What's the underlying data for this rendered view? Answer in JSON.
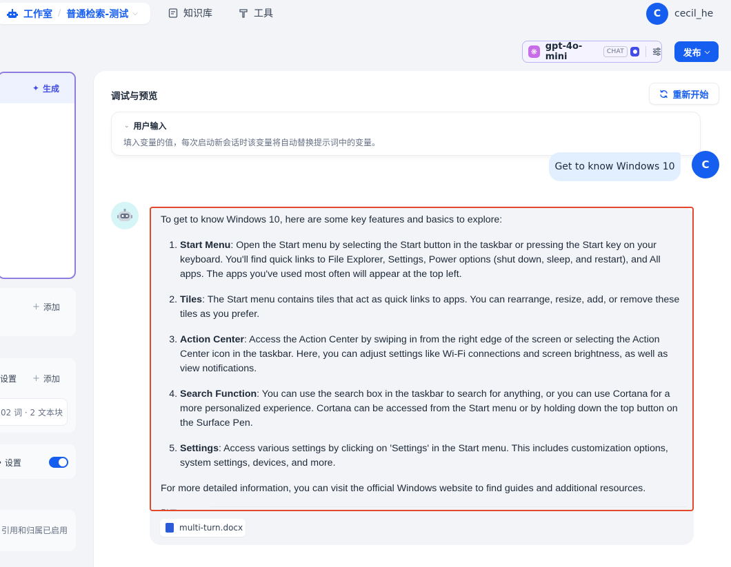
{
  "nav": {
    "studio": "工作室",
    "app_name": "普通检索-测试",
    "knowledge": "知识库",
    "tools": "工具",
    "user_initial": "C",
    "username": "cecil_he"
  },
  "left": {
    "generate": "生成",
    "add_1": "添加",
    "settings_1": "设置",
    "add_2": "添加",
    "doc_info": "02 词 · 2 文本块",
    "settings_2": "设置",
    "citation_status": "引用和归属已启用"
  },
  "toolbar": {
    "model": "gpt-4o-mini",
    "mode_badge": "CHAT",
    "publish": "发布"
  },
  "debug": {
    "title": "调试与预览",
    "restart": "重新开始",
    "user_input_title": "用户输入",
    "user_input_desc": "填入变量的值，每次启动新会话时该变量将自动替换提示词中的变量。"
  },
  "chat": {
    "user_message": "Get to know Windows 10",
    "user_initial": "C",
    "answer_intro": "To get to know Windows 10, here are some key features and basics to explore:",
    "items": [
      {
        "term": "Start Menu",
        "text": ": Open the Start menu by selecting the Start button in the taskbar or pressing the Start key on your keyboard. You'll find quick links to File Explorer, Settings, Power options (shut down, sleep, and restart), and All apps. The apps you've used most often will appear at the top left."
      },
      {
        "term": "Tiles",
        "text": ": The Start menu contains tiles that act as quick links to apps. You can rearrange, resize, add, or remove these tiles as you prefer."
      },
      {
        "term": "Action Center",
        "text": ": Access the Action Center by swiping in from the right edge of the screen or selecting the Action Center icon in the taskbar. Here, you can adjust settings like Wi-Fi connections and screen brightness, as well as view notifications."
      },
      {
        "term": "Search Function",
        "text": ": You can use the search box in the taskbar to search for anything, or you can use Cortana for a more personalized experience. Cortana can be accessed from the Start menu or by holding down the top button on the Surface Pen."
      },
      {
        "term": "Settings",
        "text": ": Access various settings by clicking on 'Settings' in the Start menu. This includes customization options, system settings, devices, and more."
      }
    ],
    "answer_outro": "For more detailed information, you can visit the official Windows website to find guides and additional resources.",
    "citation_label": "引用",
    "citation_file": "multi-turn.docx"
  }
}
